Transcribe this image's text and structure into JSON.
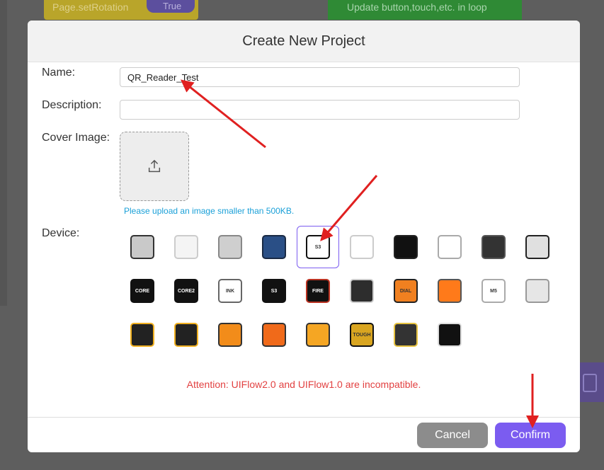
{
  "background": {
    "block_left_text": "Page.setRotation",
    "block_left_value": "True",
    "block_right_text": "Update button,touch,etc. in loop"
  },
  "dialog": {
    "title": "Create New Project",
    "name_label": "Name:",
    "name_value": "QR_Reader_Test",
    "description_label": "Description:",
    "description_value": "",
    "cover_label": "Cover Image:",
    "cover_hint": "Please upload an image smaller than 500KB.",
    "device_label": "Device:",
    "attention": "Attention: UIFlow2.0 and UIFlow1.0 are incompatible.",
    "cancel_label": "Cancel",
    "confirm_label": "Confirm"
  },
  "devices": [
    [
      {
        "id": "device-1",
        "text": ""
      },
      {
        "id": "device-2",
        "text": ""
      },
      {
        "id": "device-3",
        "text": ""
      },
      {
        "id": "device-4",
        "text": ""
      },
      {
        "id": "device-atoms3",
        "text": "S3",
        "selected": true
      },
      {
        "id": "device-6",
        "text": ""
      },
      {
        "id": "device-7",
        "text": ""
      },
      {
        "id": "device-8",
        "text": ""
      },
      {
        "id": "device-9",
        "text": ""
      },
      {
        "id": "device-10",
        "text": ""
      }
    ],
    [
      {
        "id": "device-core",
        "text": "CORE"
      },
      {
        "id": "device-core2",
        "text": "CORE2"
      },
      {
        "id": "device-coreink",
        "text": "INK"
      },
      {
        "id": "device-cores3",
        "text": "S3"
      },
      {
        "id": "device-fire",
        "text": "FIRE"
      },
      {
        "id": "device-16",
        "text": ""
      },
      {
        "id": "device-dial",
        "text": "DIAL"
      },
      {
        "id": "device-18",
        "text": ""
      },
      {
        "id": "device-m5paper",
        "text": "M5"
      },
      {
        "id": "device-20",
        "text": ""
      }
    ],
    [
      {
        "id": "device-21",
        "text": ""
      },
      {
        "id": "device-22",
        "text": ""
      },
      {
        "id": "device-23",
        "text": ""
      },
      {
        "id": "device-24",
        "text": ""
      },
      {
        "id": "device-25",
        "text": ""
      },
      {
        "id": "device-tough",
        "text": "TOUGH"
      },
      {
        "id": "device-27",
        "text": ""
      },
      {
        "id": "device-28",
        "text": ""
      }
    ]
  ]
}
